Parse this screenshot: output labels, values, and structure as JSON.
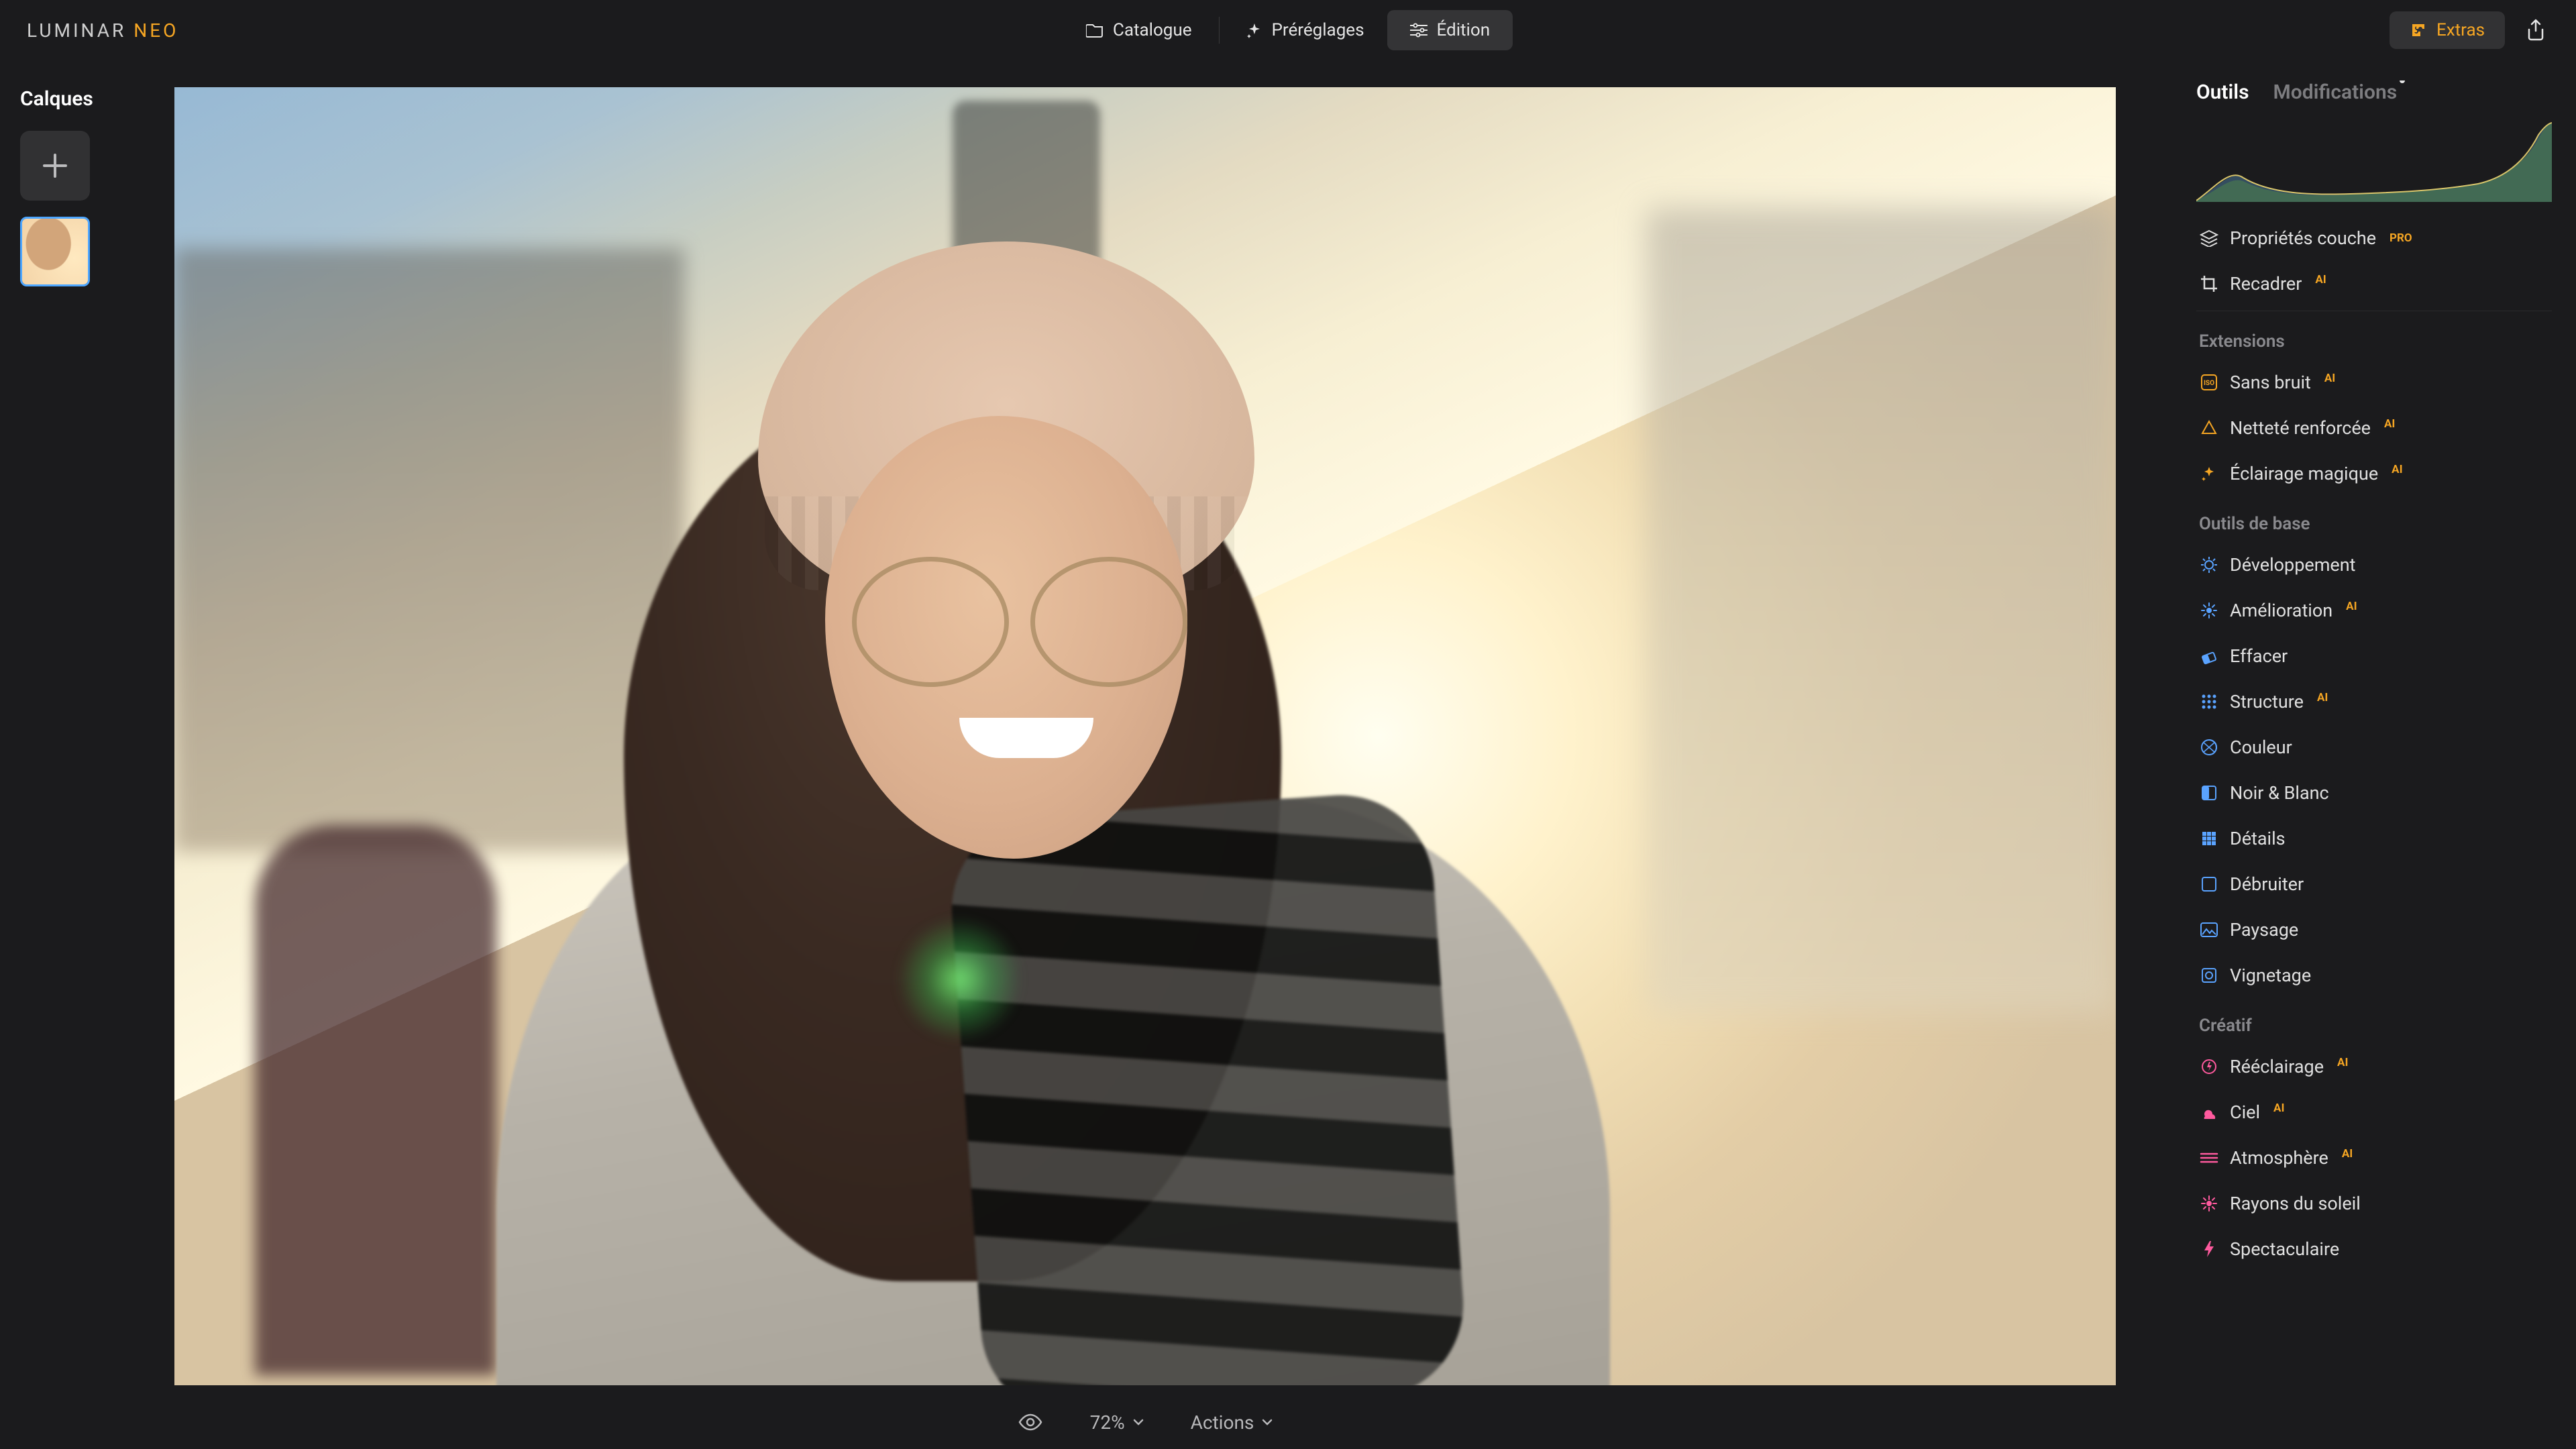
{
  "app": {
    "brand1": "LUMINAR",
    "brand2": "NEO"
  },
  "top": {
    "catalogue": "Catalogue",
    "presets": "Préréglages",
    "edit": "Édition",
    "extras": "Extras"
  },
  "left": {
    "layers_title": "Calques"
  },
  "bottom": {
    "zoom": "72%",
    "actions": "Actions"
  },
  "right": {
    "tab_tools": "Outils",
    "tab_modifications": "Modifications",
    "layer_props": "Propriétés couche",
    "crop": "Recadrer",
    "section_extensions": "Extensions",
    "noiseless": "Sans bruit",
    "supersharp": "Netteté renforcée",
    "magiclight": "Éclairage magique",
    "section_essentials": "Outils de base",
    "develop": "Développement",
    "enhance": "Amélioration",
    "erase": "Effacer",
    "structure": "Structure",
    "color": "Couleur",
    "bw": "Noir & Blanc",
    "details": "Détails",
    "denoise": "Débruiter",
    "landscape": "Paysage",
    "vignette": "Vignetage",
    "section_creative": "Créatif",
    "relight": "Rééclairage",
    "sky": "Ciel",
    "atmosphere": "Atmosphère",
    "sunrays": "Rayons du soleil",
    "dramatic": "Spectaculaire",
    "badge_pro": "PRO",
    "badge_ai": "AI"
  }
}
